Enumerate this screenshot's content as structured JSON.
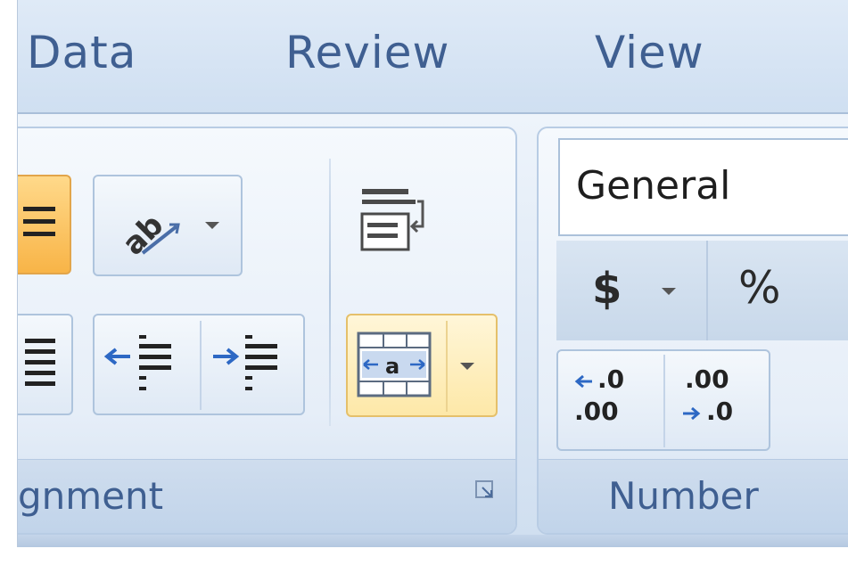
{
  "tabs": [
    {
      "label": "Data"
    },
    {
      "label": "Review"
    },
    {
      "label": "View"
    }
  ],
  "groups": {
    "alignment": {
      "label": "gnment",
      "buttons": [
        "align-right",
        "orientation",
        "justify",
        "decrease-indent",
        "increase-indent",
        "wrap-text",
        "merge-and-center"
      ]
    },
    "number": {
      "label": "Number",
      "format": {
        "value": "General"
      },
      "currency": {
        "symbol": "$"
      },
      "percent": {
        "symbol": "%"
      },
      "increase_decimal": {
        "top": ".0",
        "bottom": ".00"
      },
      "decrease_decimal": {
        "top": ".00",
        "bottom": ".0"
      }
    }
  },
  "colors": {
    "accent_text": "#3f5f91",
    "highlight_orange": "#f8b447",
    "hover_yellow": "#fde8a8"
  }
}
